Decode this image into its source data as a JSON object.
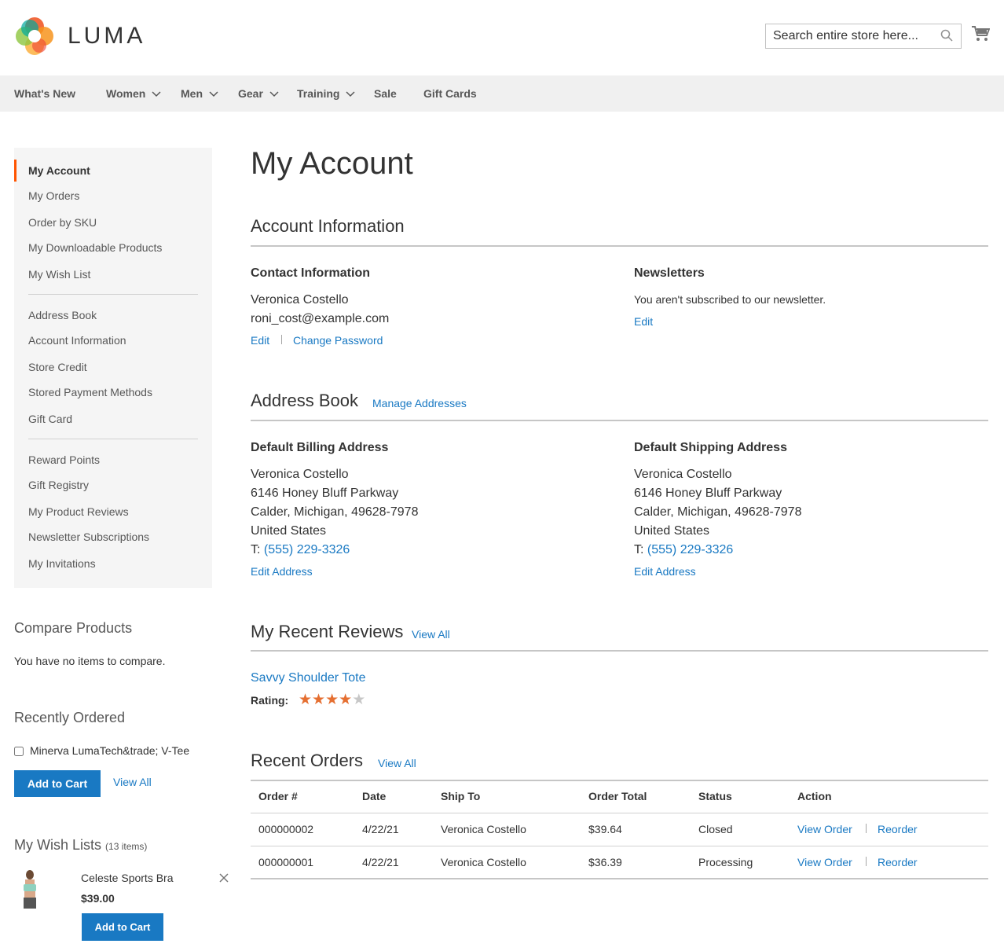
{
  "header": {
    "logo_text": "LUMA",
    "search_placeholder": "Search entire store here..."
  },
  "nav": {
    "items": [
      {
        "label": "What's New"
      },
      {
        "label": "Women"
      },
      {
        "label": "Men"
      },
      {
        "label": "Gear"
      },
      {
        "label": "Training"
      },
      {
        "label": "Sale"
      },
      {
        "label": "Gift Cards"
      }
    ]
  },
  "sidebar": {
    "items": [
      {
        "label": "My Account"
      },
      {
        "label": "My Orders"
      },
      {
        "label": "Order by SKU"
      },
      {
        "label": "My Downloadable Products"
      },
      {
        "label": "My Wish List"
      },
      {
        "label": "Address Book"
      },
      {
        "label": "Account Information"
      },
      {
        "label": "Store Credit"
      },
      {
        "label": "Stored Payment Methods"
      },
      {
        "label": "Gift Card"
      },
      {
        "label": "Reward Points"
      },
      {
        "label": "Gift Registry"
      },
      {
        "label": "My Product Reviews"
      },
      {
        "label": "Newsletter Subscriptions"
      },
      {
        "label": "My Invitations"
      }
    ]
  },
  "compare": {
    "title": "Compare Products",
    "empty_text": "You have no items to compare."
  },
  "recently_ordered": {
    "title": "Recently Ordered",
    "item_label": "Minerva LumaTech&trade; V-Tee",
    "add_to_cart": "Add to Cart",
    "view_all": "View All"
  },
  "wishlist": {
    "title": "My Wish Lists",
    "count": "(13 items)",
    "item_name": "Celeste Sports Bra",
    "item_price": "$39.00",
    "add_to_cart": "Add to Cart"
  },
  "main": {
    "page_title": "My Account",
    "account_info": {
      "title": "Account Information",
      "contact_heading": "Contact Information",
      "name": "Veronica Costello",
      "email": "roni_cost@example.com",
      "edit": "Edit",
      "change_password": "Change Password",
      "newsletters_heading": "Newsletters",
      "newsletters_text": "You aren't subscribed to our newsletter.",
      "newsletters_edit": "Edit"
    },
    "address_book": {
      "title": "Address Book",
      "manage": "Manage Addresses",
      "billing_heading": "Default Billing Address",
      "shipping_heading": "Default Shipping Address",
      "billing": {
        "name": "Veronica Costello",
        "street": "6146 Honey Bluff Parkway",
        "city": "Calder, Michigan, 49628-7978",
        "country": "United States",
        "phone_prefix": "T: ",
        "phone": "(555) 229-3326",
        "edit": "Edit Address"
      },
      "shipping": {
        "name": "Veronica Costello",
        "street": "6146 Honey Bluff Parkway",
        "city": "Calder, Michigan, 49628-7978",
        "country": "United States",
        "phone_prefix": "T: ",
        "phone": "(555) 229-3326",
        "edit": "Edit Address"
      }
    },
    "reviews": {
      "title": "My Recent Reviews",
      "view_all": "View All",
      "product": "Savvy Shoulder Tote",
      "rating_label": "Rating:",
      "rating": 4,
      "rating_max": 5
    },
    "orders": {
      "title": "Recent Orders",
      "view_all": "View All",
      "columns": [
        "Order #",
        "Date",
        "Ship To",
        "Order Total",
        "Status",
        "Action"
      ],
      "rows": [
        {
          "order": "000000002",
          "date": "4/22/21",
          "ship_to": "Veronica Costello",
          "total": "$39.64",
          "status": "Closed",
          "view": "View Order",
          "reorder": "Reorder"
        },
        {
          "order": "000000001",
          "date": "4/22/21",
          "ship_to": "Veronica Costello",
          "total": "$36.39",
          "status": "Processing",
          "view": "View Order",
          "reorder": "Reorder"
        }
      ]
    }
  },
  "colors": {
    "accent": "#1979c3",
    "active_bar": "#ff5501",
    "star": "#e56f31",
    "star_empty": "#c7c7c7"
  }
}
